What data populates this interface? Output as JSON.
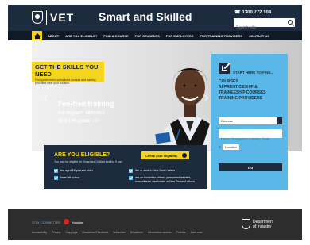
{
  "header": {
    "logo_mark": "NSW",
    "logo_text": "VET",
    "site_title": "Smart and Skilled",
    "phone": "1300 772 104",
    "search_placeholder": "Search site"
  },
  "nav": {
    "items": [
      "ABOUT",
      "ARE YOU ELIGIBLE?",
      "FIND A COURSE",
      "FOR STUDENTS",
      "FOR EMPLOYERS",
      "FOR TRAINING PROVIDERS",
      "CONTACT US"
    ]
  },
  "hero": {
    "banner_title": "GET THE SKILLS YOU NEED",
    "banner_sub": "Find government-subsidised courses and training providers near your location.",
    "line1": "Fee-free training",
    "line2": "for asylum seekers",
    "line3": "and refugees >>"
  },
  "finder": {
    "start": "START HERE TO FIND...",
    "heading_lines": [
      "COURSES",
      "APPRENTICESHIP &",
      "TRAINEESHIP COURSES",
      "TRAINING PROVIDERS"
    ],
    "select_value": "Courses",
    "field_placeholder": "Name, Occupation, Industry, Code",
    "location_label": "Location",
    "go_label": "Go"
  },
  "eligibility": {
    "title": "ARE YOU ELIGIBLE?",
    "subtitle": "You may be eligible for Smart and Skilled funding if you:",
    "button": "Check your eligibility",
    "items": [
      "are aged 15 years or older",
      "have left school",
      "live or work in New South Wales",
      "are an Australian citizen, permanent resident, humanitarian visa holder or New Zealand citizen"
    ]
  },
  "footer": {
    "connect": "STAY CONNECTED",
    "youtube": "Youtube",
    "links": [
      "Accessibility",
      "Privacy",
      "Copyright",
      "Disclaimer/Feedback",
      "Subscribe",
      "Disclaimer",
      "Information access",
      "Policies",
      "Jobs now"
    ],
    "logo_text": [
      "Department",
      "of Industry"
    ]
  },
  "colors": {
    "navy": "#1c2b3d",
    "yellow": "#f4d51e",
    "blue": "#59b8e8",
    "footer": "#2d2d2d"
  }
}
